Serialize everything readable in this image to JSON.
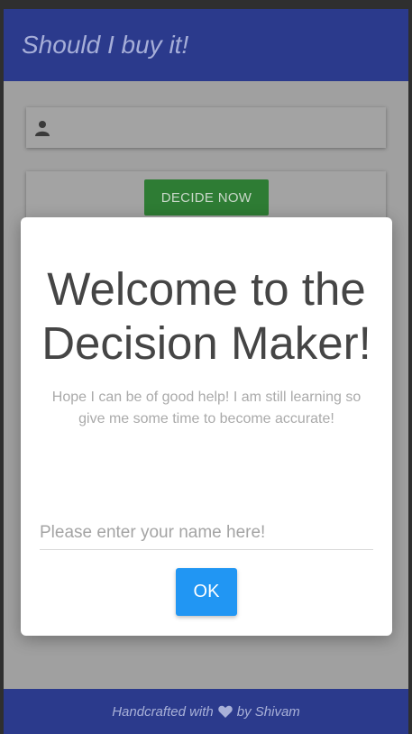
{
  "header": {
    "title": "Should I buy it!"
  },
  "main": {
    "input_icon": "user-icon",
    "decide_button_label": "DECIDE NOW"
  },
  "modal": {
    "title": "Welcome to the Decision Maker!",
    "message": "Hope I can be of good help! I am still learning so give me some time to become accurate!",
    "name_placeholder": "Please enter your name here!",
    "ok_label": "OK"
  },
  "footer": {
    "prefix": "Handcrafted with",
    "icon": "heart-icon",
    "suffix": "by Shivam"
  },
  "colors": {
    "primary": "#2b3a8c",
    "decide_button": "#2e7c34",
    "ok_button": "#2196f3"
  }
}
